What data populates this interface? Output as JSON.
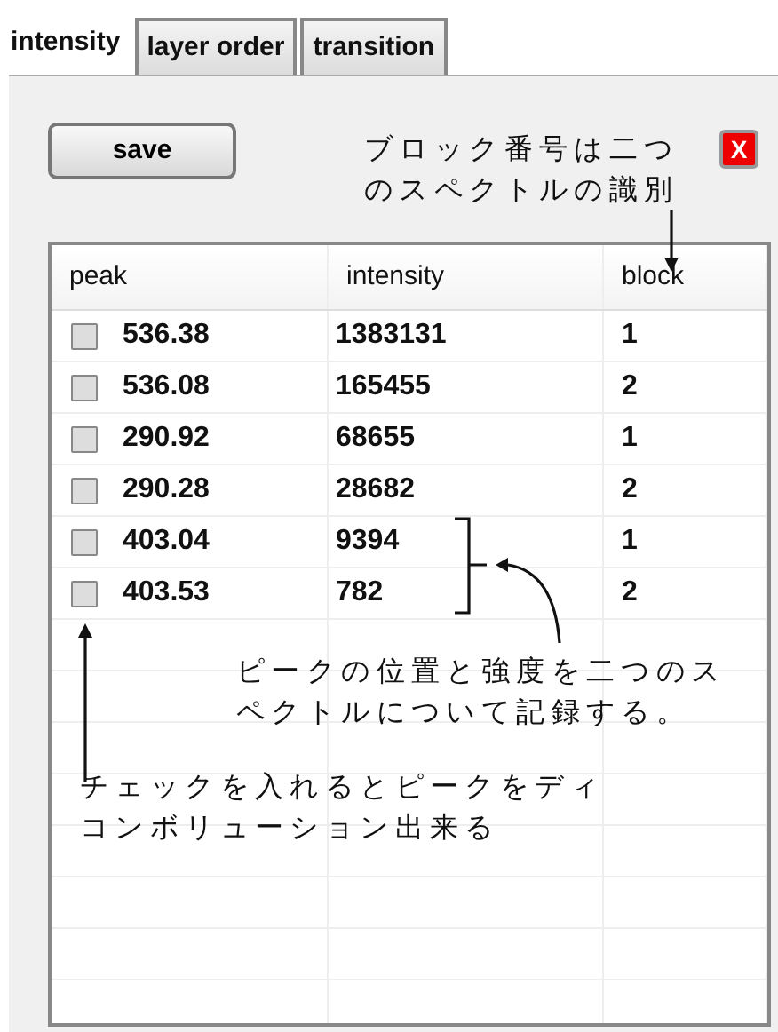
{
  "tabs": [
    {
      "label": "intensity",
      "selected": true
    },
    {
      "label": "layer order",
      "selected": false
    },
    {
      "label": "transition",
      "selected": false
    }
  ],
  "save_button": "save",
  "close_button": "X",
  "table": {
    "columns": [
      "peak",
      "intensity",
      "block"
    ],
    "rows": [
      {
        "checked": false,
        "peak": "536.38",
        "intensity": "1383131",
        "block": "1"
      },
      {
        "checked": false,
        "peak": "536.08",
        "intensity": "165455",
        "block": "2"
      },
      {
        "checked": false,
        "peak": "290.92",
        "intensity": "68655",
        "block": "1"
      },
      {
        "checked": false,
        "peak": "290.28",
        "intensity": "28682",
        "block": "2"
      },
      {
        "checked": false,
        "peak": "403.04",
        "intensity": "9394",
        "block": "1"
      },
      {
        "checked": false,
        "peak": "403.53",
        "intensity": "782",
        "block": "2"
      }
    ]
  },
  "annotations": [
    {
      "text": "ブロック番号は二つのスペクトルの識別"
    },
    {
      "text": "ピークの位置と強度を二つのスペクトルについて記録する。"
    },
    {
      "text": "チェックを入れるとピークをディコンボリューション出来る"
    }
  ]
}
